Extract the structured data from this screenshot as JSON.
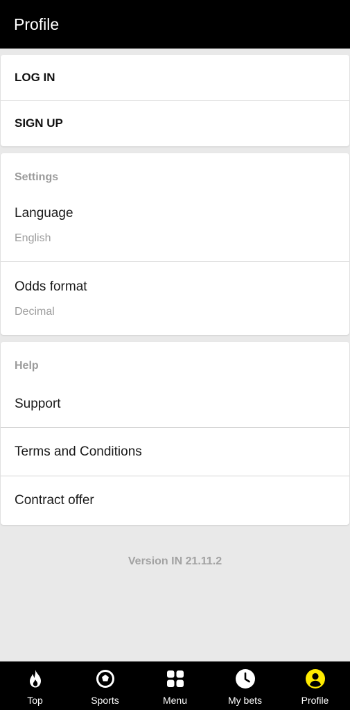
{
  "header": {
    "title": "Profile"
  },
  "auth": {
    "login_label": "LOG IN",
    "signup_label": "SIGN UP"
  },
  "settings": {
    "title": "Settings",
    "items": [
      {
        "label": "Language",
        "value": "English"
      },
      {
        "label": "Odds format",
        "value": "Decimal"
      }
    ]
  },
  "help": {
    "title": "Help",
    "items": [
      {
        "label": "Support"
      },
      {
        "label": "Terms and Conditions"
      },
      {
        "label": "Contract offer"
      }
    ]
  },
  "version": "Version IN 21.11.2",
  "bottom_nav": {
    "items": [
      {
        "label": "Top",
        "icon": "flame-icon"
      },
      {
        "label": "Sports",
        "icon": "soccer-ball-icon"
      },
      {
        "label": "Menu",
        "icon": "grid-icon"
      },
      {
        "label": "My bets",
        "icon": "clock-icon"
      },
      {
        "label": "Profile",
        "icon": "profile-icon",
        "active": true
      }
    ],
    "active_color": "#ffeb00"
  }
}
